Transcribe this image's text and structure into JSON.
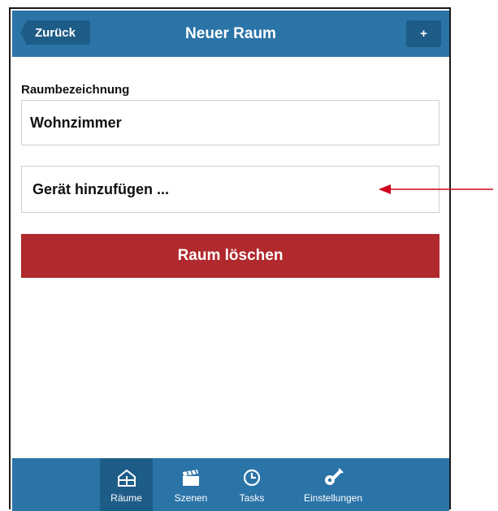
{
  "header": {
    "back_label": "Zurück",
    "title": "Neuer Raum",
    "add_label": "+"
  },
  "form": {
    "room_name_label": "Raumbezeichnung",
    "room_name_value": "Wohnzimmer",
    "add_device_label": "Gerät hinzufügen ...",
    "delete_label": "Raum löschen"
  },
  "tabbar": {
    "tabs": [
      {
        "label": "Räume",
        "icon": "house-icon",
        "active": true
      },
      {
        "label": "Szenen",
        "icon": "clapperboard-icon",
        "active": false
      },
      {
        "label": "Tasks",
        "icon": "clock-icon",
        "active": false
      },
      {
        "label": "Einstellungen",
        "icon": "wrench-gear-icon",
        "active": false
      }
    ]
  },
  "colors": {
    "header_blue": "#2b74a8",
    "button_dark_blue": "#1e5c88",
    "delete_red": "#b0292d",
    "arrow_red": "#d0021b"
  }
}
